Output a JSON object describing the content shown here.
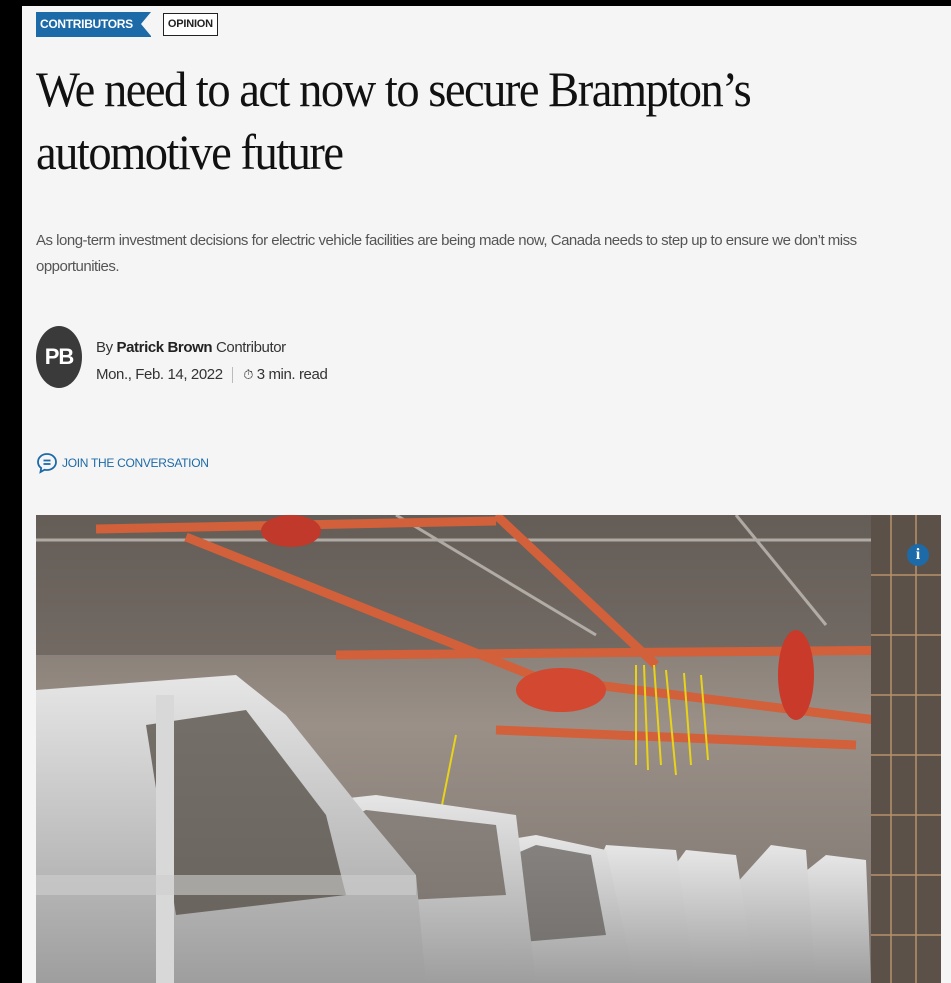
{
  "tags": {
    "primary": "CONTRIBUTORS",
    "secondary": "OPINION"
  },
  "article": {
    "headline_line1": "We need to act now to secure Brampton’s",
    "headline_line2": "automotive future",
    "dek": "As long-term investment decisions for electric vehicle facilities are being made now, Canada needs to step up to ensure we don’t miss opportunities."
  },
  "byline": {
    "avatar_initials": "PB",
    "prefix": "By",
    "author": "Patrick Brown",
    "role": "Contributor",
    "date": "Mon., Feb. 14, 2022",
    "read_time": "3 min. read",
    "timer_icon": "timer-icon"
  },
  "conversation": {
    "label": "JOIN THE CONVERSATION",
    "icon": "comment-icon"
  },
  "hero": {
    "info_label": "i",
    "info_icon": "info-icon"
  },
  "colors": {
    "accent": "#1d6aa8",
    "background": "#f5f5f5",
    "text": "#111111"
  }
}
